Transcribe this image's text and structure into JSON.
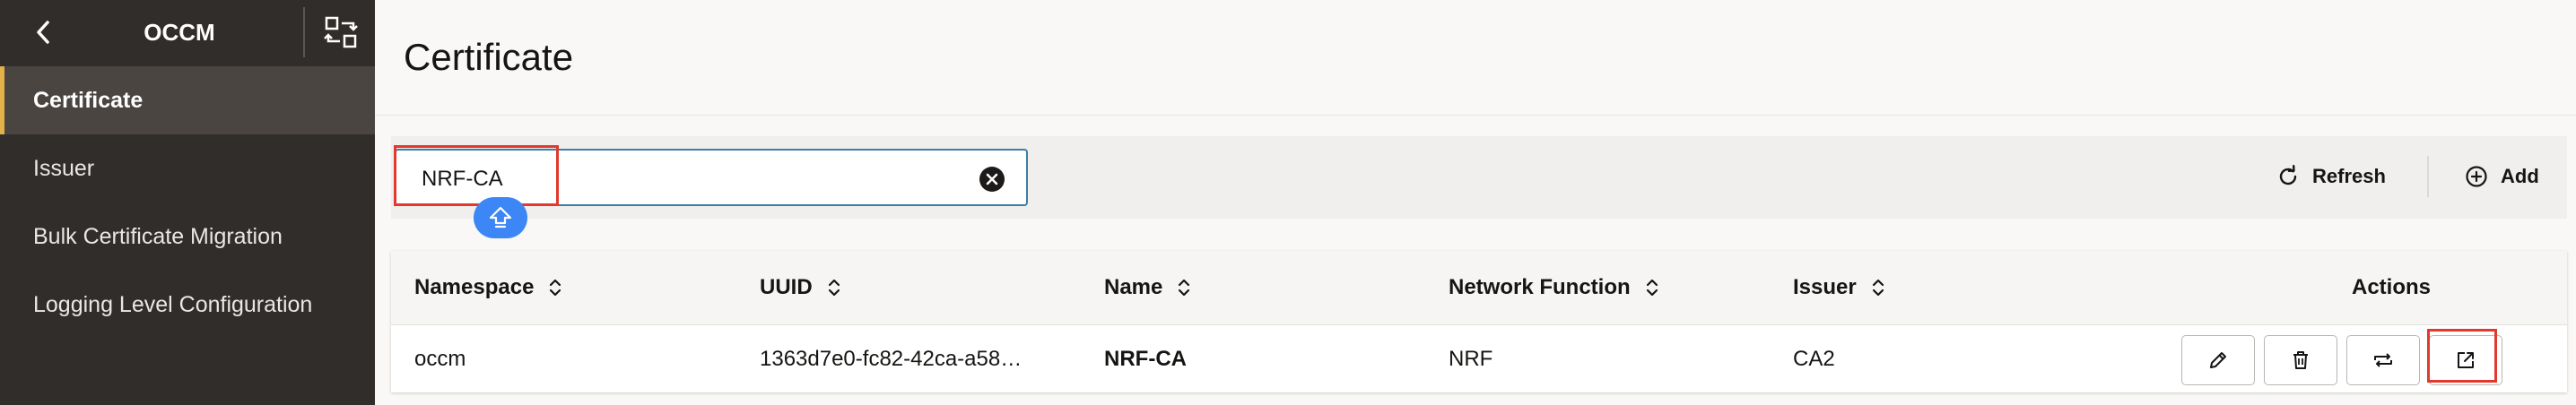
{
  "sidebar": {
    "title": "OCCM",
    "items": [
      {
        "label": "Certificate",
        "active": true
      },
      {
        "label": "Issuer",
        "active": false
      },
      {
        "label": "Bulk Certificate Migration",
        "active": false
      },
      {
        "label": "Logging Level Configuration",
        "active": false
      }
    ]
  },
  "page": {
    "title": "Certificate"
  },
  "toolbar": {
    "search_value": "NRF-CA",
    "refresh_label": "Refresh",
    "add_label": "Add"
  },
  "table": {
    "columns": [
      "Namespace",
      "UUID",
      "Name",
      "Network Function",
      "Issuer",
      "Actions"
    ],
    "rows": [
      {
        "namespace": "occm",
        "uuid": "1363d7e0-fc82-42ca-a58…",
        "name": "NRF-CA",
        "network_function": "NRF",
        "issuer": "CA2",
        "actions": [
          "edit-icon",
          "delete-icon",
          "renew-icon",
          "open-external-icon"
        ]
      }
    ]
  },
  "colors": {
    "sidebar_bg": "#312d2a",
    "active_accent": "#e2b14a",
    "highlight_box": "#e2392c",
    "search_border": "#3a7fa7",
    "cursor_badge": "#3c86f5"
  }
}
